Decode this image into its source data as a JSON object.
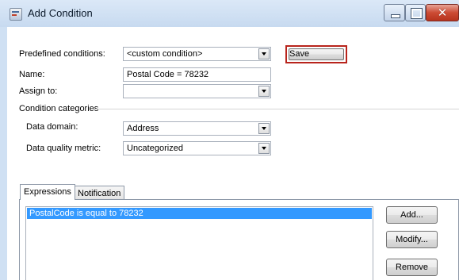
{
  "window": {
    "title": "Add Condition",
    "close_glyph": "✕"
  },
  "form": {
    "predefined_label": "Predefined conditions:",
    "predefined_value": "<custom condition>",
    "save_label": "Save",
    "name_label": "Name:",
    "name_value": "Postal Code = 78232",
    "assign_label": "Assign to:",
    "assign_value": "",
    "categories_label": "Condition categories",
    "domain_label": "Data domain:",
    "domain_value": "Address",
    "metric_label": "Data quality metric:",
    "metric_value": "Uncategorized"
  },
  "tabs": [
    {
      "label": "Expressions",
      "active": true
    },
    {
      "label": "Notification",
      "active": false
    }
  ],
  "expressions": {
    "items": [
      "PostalCode is equal to 78232"
    ],
    "add_label": "Add...",
    "modify_label": "Modify...",
    "remove_label": "Remove"
  },
  "colors": {
    "selection": "#3399ff",
    "highlight_border": "#b8241c"
  }
}
